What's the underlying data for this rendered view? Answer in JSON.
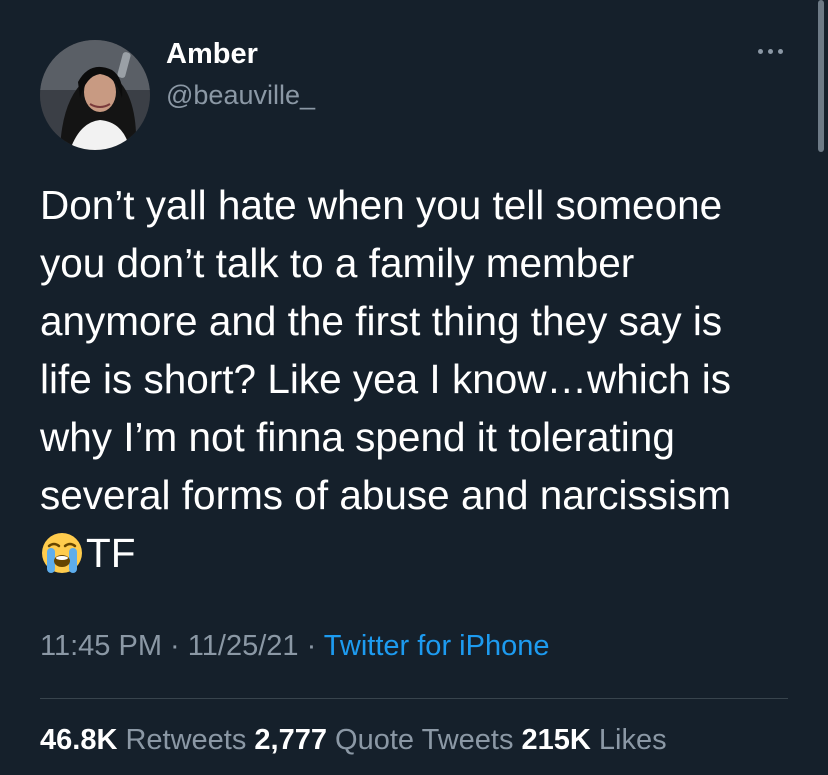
{
  "user": {
    "display_name": "Amber",
    "handle": "@beauville_",
    "avatar_icon": "profile-photo"
  },
  "tweet": {
    "lines": [
      "Don’t yall hate when you tell someone",
      "you don’t talk to a family member",
      "anymore and the first thing they say is",
      "life is short? Like yea I know…which is",
      "why I’m not finna spend it tolerating",
      "several forms of abuse and narcissism"
    ],
    "last_line_emoji": "loudly-crying-face-emoji",
    "last_line_text": "TF"
  },
  "meta": {
    "time": "11:45 PM",
    "separator": "·",
    "date": "11/25/21",
    "source": "Twitter for iPhone"
  },
  "stats": {
    "retweets_count": "46.8K",
    "retweets_label": "Retweets",
    "quotes_count": "2,777",
    "quotes_label": "Quote Tweets",
    "likes_count": "215K",
    "likes_label": "Likes"
  },
  "colors": {
    "background": "#15202b",
    "text": "#ffffff",
    "secondary": "#8b98a5",
    "link": "#1d9bf0",
    "divider": "#38444d"
  }
}
